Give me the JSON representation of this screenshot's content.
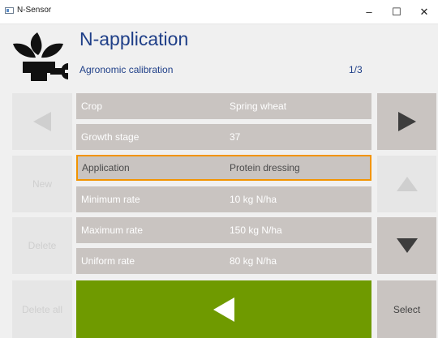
{
  "window": {
    "title": "N-Sensor",
    "minimize_glyph": "–",
    "maximize_glyph": "☐",
    "close_glyph": "✕"
  },
  "header": {
    "title": "N-application",
    "subtitle": "Agronomic calibration",
    "page_counter": "1/3"
  },
  "left_buttons": {
    "new_label": "New",
    "delete_label": "Delete",
    "delete_all_label": "Delete all"
  },
  "right_buttons": {
    "select_label": "Select"
  },
  "rows": [
    {
      "label": "Crop",
      "value": "Spring wheat"
    },
    {
      "label": "Growth stage",
      "value": "37"
    },
    {
      "label": "Application",
      "value": "Protein dressing"
    },
    {
      "label": "Minimum rate",
      "value": "10 kg N/ha"
    },
    {
      "label": "Maximum rate",
      "value": "150 kg N/ha"
    },
    {
      "label": "Uniform rate",
      "value": "80 kg N/ha"
    }
  ],
  "icons": {
    "logo": "plant-wrench-icon",
    "prev": "triangle-left-icon",
    "next": "triangle-right-icon",
    "up": "triangle-up-icon",
    "down": "triangle-down-icon",
    "back": "triangle-left-icon"
  },
  "colors": {
    "title_blue": "#1f3f88",
    "row_gray": "#c9c4c1",
    "selected_border": "#f29400",
    "back_green": "#6f9a00",
    "disabled_gray": "#e6e6e6"
  }
}
